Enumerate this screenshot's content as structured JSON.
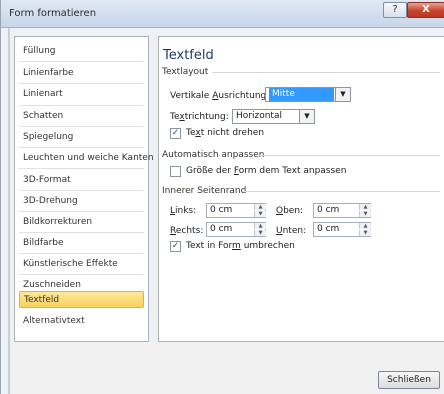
{
  "window": {
    "title": "Form formatieren",
    "help_label": "?",
    "close_label": "X"
  },
  "sidebar": {
    "items": [
      {
        "label": "Füllung"
      },
      {
        "label": "Linienfarbe"
      },
      {
        "label": "Linienart"
      },
      {
        "label": "Schatten"
      },
      {
        "label": "Spiegelung"
      },
      {
        "label": "Leuchten und weiche Kanten"
      },
      {
        "label": "3D-Format"
      },
      {
        "label": "3D-Drehung"
      },
      {
        "label": "Bildkorrekturen"
      },
      {
        "label": "Bildfarbe"
      },
      {
        "label": "Künstlerische Effekte"
      },
      {
        "label": "Zuschneiden"
      },
      {
        "label": "Textfeld"
      },
      {
        "label": "Alternativtext"
      }
    ],
    "active_index": 12
  },
  "panel": {
    "title": "Textfeld",
    "textlayout": {
      "section_label": "Textlayout",
      "vertical_label": "Vertikale Ausrichtung:",
      "vertical_value": "Mitte",
      "direction_label": "Textrichtung:",
      "direction_value": "Horizontal",
      "no_rotate_label": "Text nicht drehen",
      "no_rotate_checked": true
    },
    "autofit": {
      "section_label": "Automatisch anpassen",
      "resize_label": "Größe der Form dem Text anpassen",
      "resize_checked": false
    },
    "margins": {
      "section_label": "Innerer Seitenrand",
      "left_label": "Links:",
      "left_value": "0 cm",
      "top_label": "Oben:",
      "top_value": "0 cm",
      "right_label": "Rechts:",
      "right_value": "0 cm",
      "bottom_label": "Unten:",
      "bottom_value": "0 cm",
      "wrap_label": "Text in Form umbrechen",
      "wrap_checked": true
    }
  },
  "footer": {
    "close_button_label": "Schließen"
  }
}
